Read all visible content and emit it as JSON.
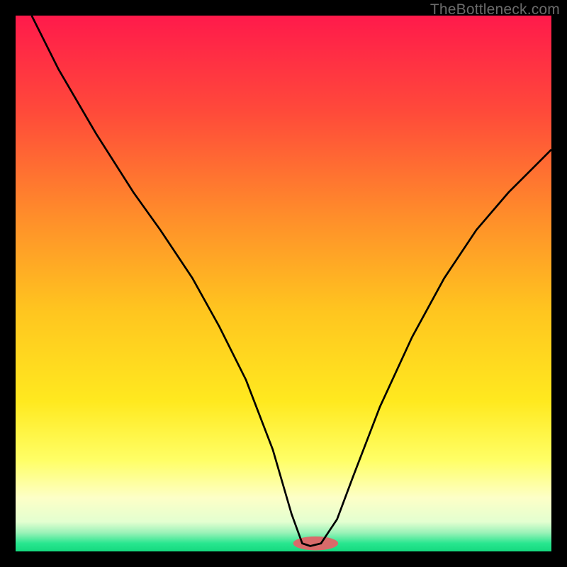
{
  "watermark": "TheBottleneck.com",
  "chart_data": {
    "type": "line",
    "title": "",
    "xlabel": "",
    "ylabel": "",
    "xlim": [
      0,
      100
    ],
    "ylim": [
      0,
      100
    ],
    "background_gradient": {
      "stops": [
        {
          "offset": 0.0,
          "color": "#ff1a4b"
        },
        {
          "offset": 0.18,
          "color": "#ff4a3a"
        },
        {
          "offset": 0.38,
          "color": "#ff8f2a"
        },
        {
          "offset": 0.55,
          "color": "#ffc51f"
        },
        {
          "offset": 0.72,
          "color": "#ffe91f"
        },
        {
          "offset": 0.83,
          "color": "#ffff66"
        },
        {
          "offset": 0.9,
          "color": "#fdffc7"
        },
        {
          "offset": 0.945,
          "color": "#e3ffd0"
        },
        {
          "offset": 0.965,
          "color": "#9bf2b8"
        },
        {
          "offset": 0.985,
          "color": "#28e68f"
        },
        {
          "offset": 1.0,
          "color": "#15d97f"
        }
      ]
    },
    "series": [
      {
        "name": "bottleneck-curve",
        "stroke": "#000000",
        "x": [
          3,
          8,
          15,
          22,
          27,
          33,
          38,
          43,
          48,
          51.5,
          53.5,
          55,
          57,
          60,
          63,
          68,
          74,
          80,
          86,
          92,
          97,
          100
        ],
        "values": [
          100,
          90,
          78,
          67,
          60,
          51,
          42,
          32,
          19,
          7,
          1.5,
          1,
          1.5,
          6,
          14,
          27,
          40,
          51,
          60,
          67,
          72,
          75
        ]
      }
    ],
    "baseline_marker": {
      "cx": 56,
      "cy": 1.5,
      "rx": 4.2,
      "ry": 1.3,
      "color": "#d96a6a"
    }
  }
}
